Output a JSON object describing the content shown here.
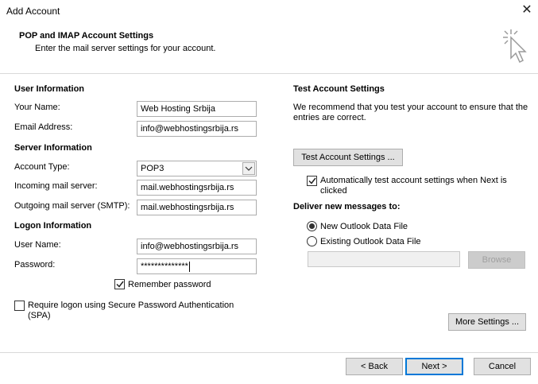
{
  "window": {
    "title": "Add Account",
    "close_glyph": "✕"
  },
  "header": {
    "title": "POP and IMAP Account Settings",
    "subtitle": "Enter the mail server settings for your account."
  },
  "user_info": {
    "section": "User Information",
    "name_label": "Your Name:",
    "name_value": "Web Hosting Srbija",
    "email_label": "Email Address:",
    "email_value": "info@webhostingsrbija.rs"
  },
  "server_info": {
    "section": "Server Information",
    "account_type_label": "Account Type:",
    "account_type_value": "POP3",
    "incoming_label": "Incoming mail server:",
    "incoming_value": "mail.webhostingsrbija.rs",
    "outgoing_label": "Outgoing mail server (SMTP):",
    "outgoing_value": "mail.webhostingsrbija.rs"
  },
  "logon_info": {
    "section": "Logon Information",
    "username_label": "User Name:",
    "username_value": "info@webhostingsrbija.rs",
    "password_label": "Password:",
    "password_value": "**************",
    "remember_label": "Remember password",
    "remember_checked": true,
    "spa_label": "Require logon using Secure Password Authentication (SPA)",
    "spa_checked": false
  },
  "test_settings": {
    "section": "Test Account Settings",
    "description": "We recommend that you test your account to ensure that the entries are correct.",
    "test_button": "Test Account Settings ...",
    "auto_test_label": "Automatically test account settings when Next is clicked",
    "auto_test_checked": true
  },
  "deliver": {
    "section": "Deliver new messages to:",
    "new_file_label": "New Outlook Data File",
    "existing_file_label": "Existing Outlook Data File",
    "selected": "new",
    "path_value": "",
    "browse_button": "Browse"
  },
  "more_settings_button": "More Settings ...",
  "footer": {
    "back_button": "< Back",
    "next_button": "Next >",
    "cancel_button": "Cancel"
  },
  "colors": {
    "accent": "#0078d7",
    "button_bg": "#e1e1e1",
    "border": "#adadad"
  }
}
